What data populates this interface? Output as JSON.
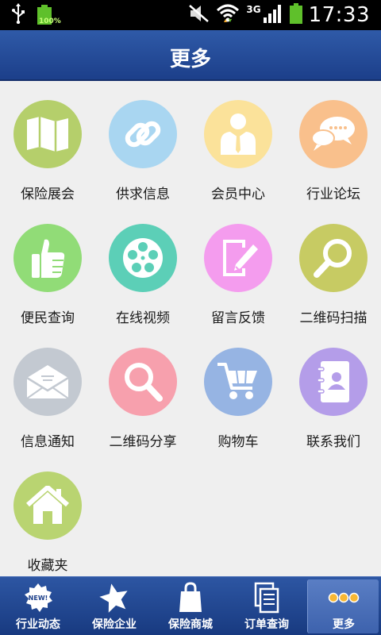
{
  "status_bar": {
    "time": "17:33",
    "battery_label": "100%",
    "network_label": "3G",
    "icons": [
      "usb-icon",
      "battery-full-icon",
      "mute-icon",
      "wifi-icon",
      "signal-icon",
      "battery-icon"
    ]
  },
  "header": {
    "title": "更多"
  },
  "grid": {
    "items": [
      {
        "label": "保险展会",
        "icon": "map-icon",
        "color": "#b5cf6b"
      },
      {
        "label": "供求信息",
        "icon": "link-icon",
        "color": "#a9d6f1"
      },
      {
        "label": "会员中心",
        "icon": "member-icon",
        "color": "#fbe29a"
      },
      {
        "label": "行业论坛",
        "icon": "chat-icon",
        "color": "#f9c08c"
      },
      {
        "label": "便民查询",
        "icon": "thumbs-up-icon",
        "color": "#91dc77"
      },
      {
        "label": "在线视频",
        "icon": "film-reel-icon",
        "color": "#5ccfb7"
      },
      {
        "label": "留言反馈",
        "icon": "edit-icon",
        "color": "#f49cee"
      },
      {
        "label": "二维码扫描",
        "icon": "magnifier-icon",
        "color": "#c7cb63"
      },
      {
        "label": "信息通知",
        "icon": "mail-icon",
        "color": "#c3c9d1"
      },
      {
        "label": "二维码分享",
        "icon": "magnifier-icon",
        "color": "#f7a0ad"
      },
      {
        "label": "购物车",
        "icon": "cart-icon",
        "color": "#96b4e3"
      },
      {
        "label": "联系我们",
        "icon": "contacts-icon",
        "color": "#b49de9"
      },
      {
        "label": "收藏夹",
        "icon": "home-icon",
        "color": "#b9d471"
      }
    ]
  },
  "bottom_nav": {
    "tabs": [
      {
        "label": "行业动态",
        "icon": "news-badge-icon"
      },
      {
        "label": "保险企业",
        "icon": "star-icon"
      },
      {
        "label": "保险商城",
        "icon": "shopping-bag-icon"
      },
      {
        "label": "订单查询",
        "icon": "documents-icon"
      },
      {
        "label": "更多",
        "icon": "more-dots-icon",
        "active": true
      }
    ],
    "badge_text": "NEW!"
  }
}
